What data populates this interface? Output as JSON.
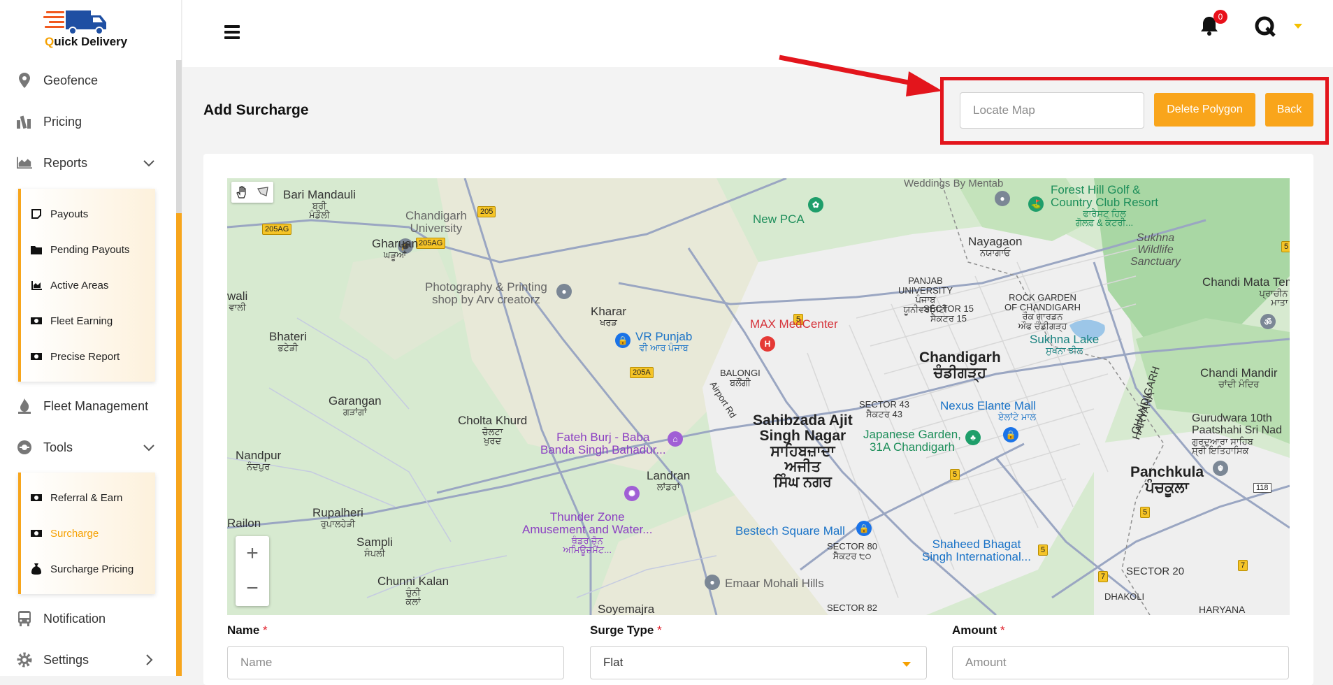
{
  "app": {
    "brand_part1": "Q",
    "brand_part2": "uick Delivery",
    "notification_count": "0",
    "accent_color": "#f9a51b"
  },
  "sidebar": {
    "items": [
      {
        "label": "Geofence",
        "icon": "location-pin-icon"
      },
      {
        "label": "Pricing",
        "icon": "pricing-icon"
      },
      {
        "label": "Reports",
        "icon": "chart-area-icon"
      },
      {
        "label": "Fleet Management",
        "icon": "fleet-icon"
      },
      {
        "label": "Tools",
        "icon": "tools-icon"
      },
      {
        "label": "Notification",
        "icon": "bus-icon"
      },
      {
        "label": "Settings",
        "icon": "gear-icon"
      }
    ],
    "reports_sub": [
      {
        "label": "Payouts",
        "icon": "note-icon"
      },
      {
        "label": "Pending Payouts",
        "icon": "folder-icon"
      },
      {
        "label": "Active Areas",
        "icon": "chart-icon"
      },
      {
        "label": "Fleet Earning",
        "icon": "money-icon"
      },
      {
        "label": "Precise Report",
        "icon": "money-icon"
      }
    ],
    "tools_sub": [
      {
        "label": "Referral & Earn",
        "icon": "money-icon"
      },
      {
        "label": "Surcharge",
        "icon": "money-icon",
        "active": true
      },
      {
        "label": "Surcharge Pricing",
        "icon": "money-bag-icon"
      }
    ]
  },
  "page": {
    "title": "Add Surcharge",
    "locate_placeholder": "Locate Map",
    "delete_polygon_label": "Delete Polygon",
    "back_label": "Back"
  },
  "map": {
    "labels": {
      "bari_mandauli": "Bari Mandauli",
      "bari_mandauli_pa": "ਬਰੀ\nਮੰਡੌਲੀ",
      "chandigarh_university": "Chandigarh\nUniversity",
      "gharuan": "Gharuan",
      "gharuan_pa": "ਘੜੂਆਂ",
      "photo_shop": "Photography & Printing\nshop by Arv creatorz",
      "kharar": "Kharar",
      "kharar_pa": "ਖਰੜ",
      "wali": "wali",
      "wali_pa": "ਵਾਲੀ",
      "bhateri": "Bhateri",
      "bhateri_pa": "ਭਟੇੜੀ",
      "garangan": "Garangan",
      "garangan_pa": "ਗੜਾਂਗਾਂ",
      "cholta_khurd": "Cholta Khurd",
      "cholta_khurd_pa": "ਚੋਲਟਾ\nਖੁਰਦ",
      "nandpur": "Nandpur",
      "nandpur_pa": "ਨੰਦਪੁਰ",
      "railon": "Railon",
      "rupalheri": "Rupalheri",
      "rupalheri_pa": "ਰੁਪਾਲਹੇੜੀ",
      "sampli": "Sampli",
      "sampli_pa": "ਸੰਪਲੀ",
      "chunni_kalan": "Chunni Kalan",
      "chunni_kalan_pa": "ਚੁੰਨੀ\nਕਲਾਂ",
      "soyemajra": "Soyemajra",
      "landran": "Landran",
      "landran_pa": "ਲਾਂਡਰਾਂ",
      "fateh_burj": "Fateh Burj - Baba\nBanda Singh Bahadur...",
      "thunder_zone": "Thunder Zone\nAmusement and Water...",
      "thunder_zone_pa": "ਥੰਡਰ ਜ਼ੋਨ\nਅਮਿਊਜ਼ਮੈਂਟ...",
      "vr_punjab": "VR Punjab",
      "vr_punjab_pa": "ਵੀ ਆਰ ਪੰਜਾਬ",
      "new_pca": "New PCA",
      "max_medcenter": "MAX MedCenter",
      "balongi": "BALONGI",
      "balongi_pa": "ਬਲੌਂਗੀ",
      "airport_rd": "Airport Rd",
      "sas_nagar": "Sahibzada Ajit\nSingh Nagar",
      "sas_nagar_pa": "ਸਾਹਿਬਜ਼ਾਦਾ\nਅਜੀਤ\nਸਿੰਘ ਨਗਰ",
      "bestech": "Bestech Square Mall",
      "sector80": "SECTOR 80",
      "sector80_pa": "ਸੈਕਟਰ ੮੦",
      "emaar": "Emaar Mohali Hills",
      "sector82": "SECTOR 82",
      "weddings": "Weddings By Mentab",
      "forest_hill": "Forest Hill Golf &\nCountry Club Resort",
      "forest_hill_pa": "ਫਾਰੈਸਟ ਹਿਲ\nਗੋਲਫ਼ & ਕੰਟਰੀ...",
      "nayagaon": "Nayagaon",
      "nayagaon_pa": "ਨਯਾਗਾਓ",
      "sukhna_sanctuary": "Sukhna\nWildlife\nSanctuary",
      "chandi_mata": "Chandi Mata Temple",
      "chandi_mata_pa": "ਪ੍ਰਾਚੀਨ ਚਣਡੀ\nਮਾਤਾ ਮੰਦਿਰ",
      "panjab_university": "PANJAB\nUNIVERSITY",
      "panjab_university_pa": "ਪੰਜਾਬ\nਯੂਨੀਵਰਸਿਟੀ",
      "sector15": "SECTOR 15",
      "sector15_pa": "ਸੈਕਟਰ 15",
      "rock_garden": "ROCK GARDEN\nOF CHANDIGARH",
      "rock_garden_pa": "ਰੌਕ ਗਾਰਡਨ\nਔਫ ਚੰਡੀਗੜ੍ਹ",
      "sukhna_lake": "Sukhna Lake",
      "sukhna_lake_pa": "ਸੁਖਨਾ ਝੀਲ",
      "chandigarh": "Chandigarh",
      "chandigarh_pa": "ਚੰਡੀਗੜ੍ਹ",
      "sector43": "SECTOR 43",
      "sector43_pa": "ਸੈਕਟਰ 43",
      "nexus": "Nexus Elante Mall",
      "nexus_pa": "ਏਲਾਂਟੇ ਮਾਲ",
      "japanese_garden": "Japanese Garden,\n31A Chandigarh",
      "chandigarh_border": "CHANDIGARH",
      "haryana_border": "HARYANA",
      "chandi_mandir": "Chandi Mandir",
      "chandi_mandir_pa": "ਚਾਂਦੀ ਮੰਦਿਰ",
      "gurudwara": "Gurudwara 10th\nPaatshahi Sri Nad",
      "gurudwara_pa": "ਗੁਰਦੁਆਰਾ ਸਾਹਿਬ\nਸ਼੍ਰੀ ਇਤਿਹਾਸਿਕ",
      "panchkula": "Panchkula",
      "panchkula_pa": "ਪੰਚਕੂਲਾ",
      "shaheed": "Shaheed Bhagat\nSingh International...",
      "sector20": "SECTOR 20",
      "dhakoli": "DHAKOLI",
      "haryana_bottom": "HARYANA"
    },
    "shields": {
      "r205ag_a": "205AG",
      "r205ag_b": "205AG",
      "r205": "205",
      "r205a": "205A",
      "r5a": "5",
      "r5b": "5",
      "r5c": "5",
      "r5d": "5",
      "r5e": "5",
      "r7a": "7",
      "r7b": "7",
      "r118": "118"
    },
    "zoom_in": "+",
    "zoom_out": "−"
  },
  "form": {
    "name_label": "Name",
    "name_placeholder": "Name",
    "surge_type_label": "Surge Type",
    "surge_type_value": "Flat",
    "amount_label": "Amount",
    "amount_placeholder": "Amount",
    "required_mark": "*"
  }
}
